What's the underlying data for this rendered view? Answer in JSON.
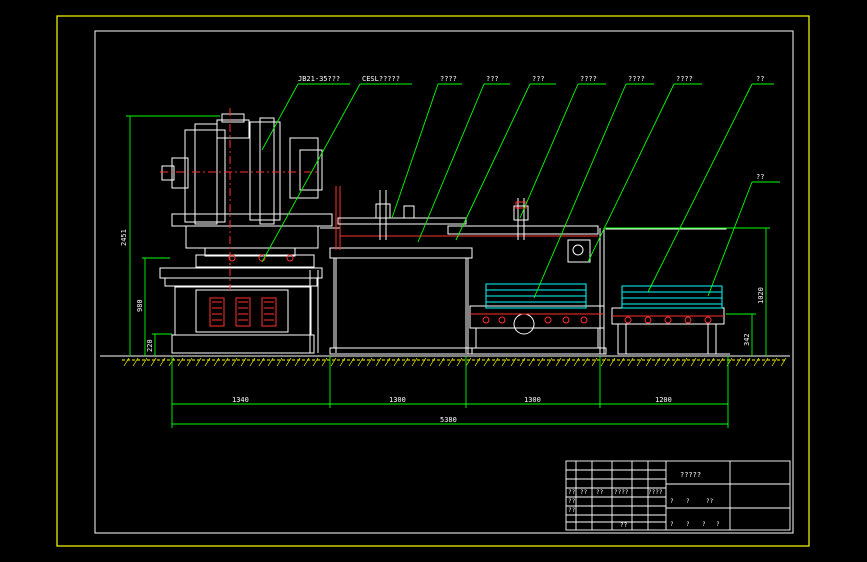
{
  "colors": {
    "background": "#000000",
    "frame": "#ffff00",
    "outline": "#ffffff",
    "leader": "#00ff00",
    "dimension": "#00ff00",
    "centerline": "#ff0000",
    "machine_red": "#ff3030",
    "accent_cyan": "#00ffff",
    "ground": "#ffff00"
  },
  "labels": {
    "press": "JB21-35???",
    "feeder": "CESL?????",
    "l3": "????",
    "l4": "???",
    "l5": "???",
    "l6": "????",
    "l7": "????",
    "l8": "????",
    "l9": "??",
    "l10": "??"
  },
  "dimensions": {
    "overall_height": "2451",
    "press_base_height": "980",
    "foot_height": "220",
    "conveyor_height": "1020",
    "table_height": "342",
    "seg1": "1340",
    "seg2": "1300",
    "seg3": "1300",
    "seg4": "1200",
    "total": "5380"
  },
  "title_block": {
    "drawing_name": "?????",
    "row_a": [
      "??",
      "??",
      "??",
      "????",
      "????"
    ],
    "row_b": [
      "??"
    ],
    "row_c": [
      "??",
      "",
      "",
      "??"
    ],
    "right_top": [
      "?",
      "?",
      "??"
    ],
    "right_bottom": [
      "?",
      "?",
      "?",
      "?"
    ]
  }
}
